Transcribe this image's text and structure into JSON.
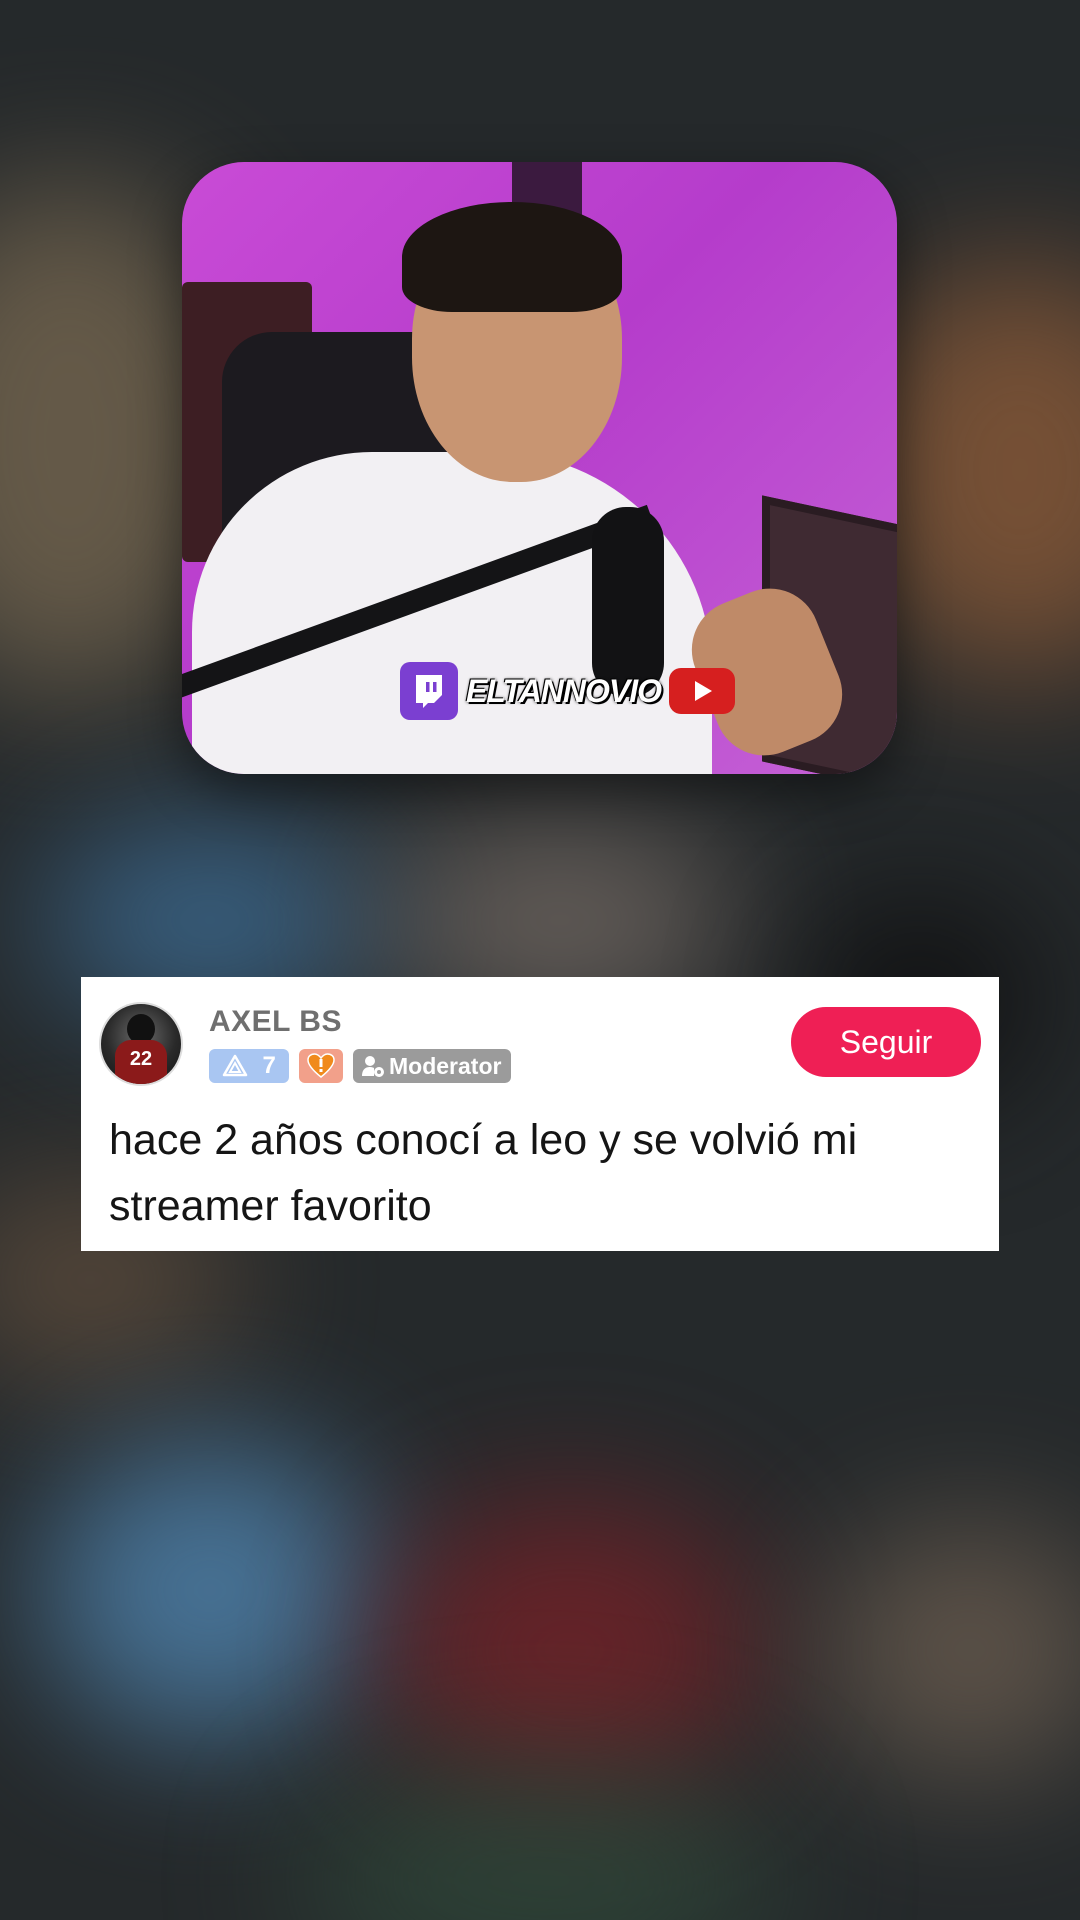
{
  "video": {
    "watermark_text": "ELTANNOVIO"
  },
  "comment": {
    "username": "AXEL BS",
    "avatar_jersey_number": "22",
    "level_badge": "7",
    "role_badge": "Moderator",
    "follow_label": "Seguir",
    "text": "hace 2 años conocí a leo y se volvió mi streamer favorito"
  },
  "colors": {
    "follow_button": "#ef1f55",
    "level_badge": "#a9c6f2",
    "heart_badge": "#f2a08a",
    "moderator_badge": "#9b9b9b",
    "twitch": "#7b3fd1",
    "youtube": "#d61f1f"
  },
  "icons": {
    "level": "triangle-level-icon",
    "heart": "heart-badge-icon",
    "moderator": "moderator-person-icon",
    "twitch": "twitch-logo-icon",
    "youtube": "youtube-play-icon"
  }
}
